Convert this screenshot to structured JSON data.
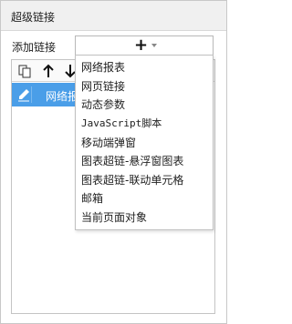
{
  "dialog": {
    "title": "超级链接"
  },
  "add_section": {
    "label": "添加链接",
    "button_icon": "plus-icon"
  },
  "toolbar": {
    "icons": [
      "copy-icon",
      "arrow-up-icon",
      "arrow-down-icon"
    ]
  },
  "links": [
    {
      "label": "网络报",
      "icon": "pencil-icon",
      "selected": true
    }
  ],
  "dropdown_menu": {
    "items": [
      "网络报表",
      "网页链接",
      "动态参数",
      "JavaScript脚本",
      "移动端弹窗",
      "图表超链-悬浮窗图表",
      "图表超链-联动单元格",
      "邮箱",
      "当前页面对象"
    ]
  },
  "colors": {
    "selection": "#4a9ee8",
    "title_bar": "#f0f0f0"
  }
}
